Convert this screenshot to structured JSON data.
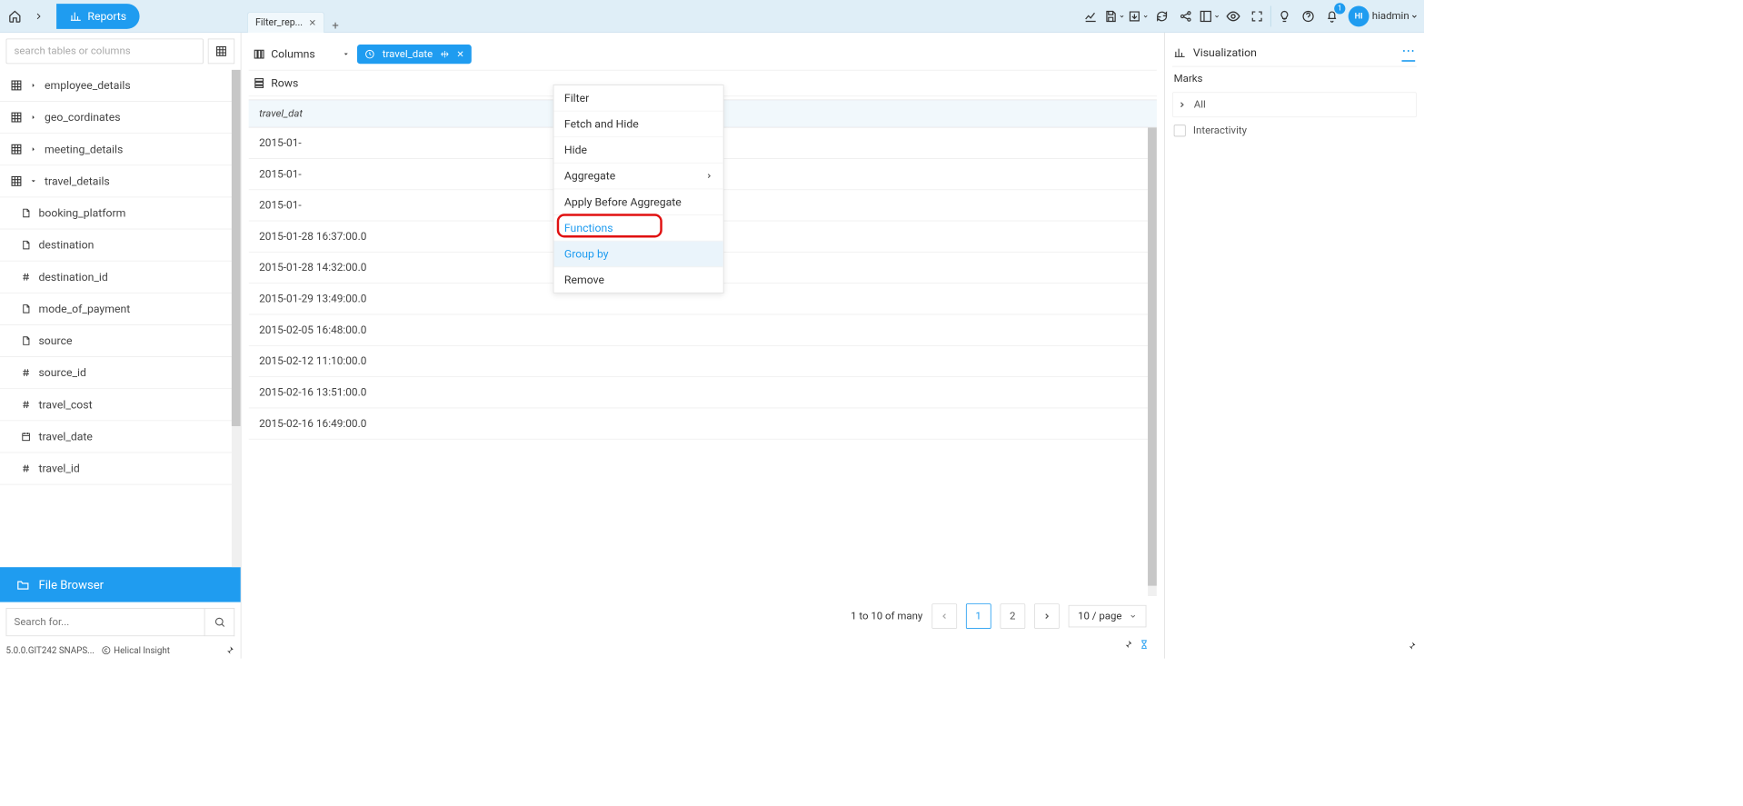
{
  "topbar": {
    "reports_label": "Reports",
    "notification_count": "1",
    "avatar_initials": "HI",
    "username": "hiadmin"
  },
  "tabs": {
    "active_label": "Filter_rep..."
  },
  "sidebar": {
    "search_placeholder": "search tables or columns",
    "tables": [
      {
        "name": "employee_details",
        "expanded": false
      },
      {
        "name": "geo_cordinates",
        "expanded": false
      },
      {
        "name": "meeting_details",
        "expanded": false
      },
      {
        "name": "travel_details",
        "expanded": true
      }
    ],
    "travel_details_columns": [
      {
        "name": "booking_platform",
        "icon": "file"
      },
      {
        "name": "destination",
        "icon": "file"
      },
      {
        "name": "destination_id",
        "icon": "hash"
      },
      {
        "name": "mode_of_payment",
        "icon": "file"
      },
      {
        "name": "source",
        "icon": "file"
      },
      {
        "name": "source_id",
        "icon": "hash"
      },
      {
        "name": "travel_cost",
        "icon": "hash"
      },
      {
        "name": "travel_date",
        "icon": "calendar"
      },
      {
        "name": "travel_id",
        "icon": "hash"
      }
    ],
    "file_browser_label": "File Browser",
    "search_for_placeholder": "Search for...",
    "version": "5.0.0.GIT242 SNAPS...",
    "brand": "Helical Insight"
  },
  "shelves": {
    "columns_label": "Columns",
    "rows_label": "Rows",
    "column_pill": "travel_date"
  },
  "context_menu": {
    "items": [
      {
        "label": "Filter",
        "sub": false
      },
      {
        "label": "Fetch and Hide",
        "sub": false
      },
      {
        "label": "Hide",
        "sub": false
      },
      {
        "label": "Aggregate",
        "sub": true
      },
      {
        "label": "Apply Before Aggregate",
        "sub": false
      },
      {
        "label": "Functions",
        "sub": false,
        "highlighted": true,
        "ring": true
      },
      {
        "label": "Group by",
        "sub": false,
        "selected": true
      },
      {
        "label": "Remove",
        "sub": false
      }
    ]
  },
  "table": {
    "header": "travel_dat",
    "rows": [
      "2015-01-",
      "2015-01-",
      "2015-01-",
      "2015-01-28 16:37:00.0",
      "2015-01-28 14:32:00.0",
      "2015-01-29 13:49:00.0",
      "2015-02-05 16:48:00.0",
      "2015-02-12 11:10:00.0",
      "2015-02-16 13:51:00.0",
      "2015-02-16 16:49:00.0"
    ]
  },
  "pager": {
    "summary": "1 to 10 of many",
    "pages": [
      "1",
      "2"
    ],
    "active_page": "1",
    "page_size_label": "10 / page"
  },
  "right_panel": {
    "visualization_label": "Visualization",
    "marks_label": "Marks",
    "all_label": "All",
    "interactivity_label": "Interactivity"
  }
}
